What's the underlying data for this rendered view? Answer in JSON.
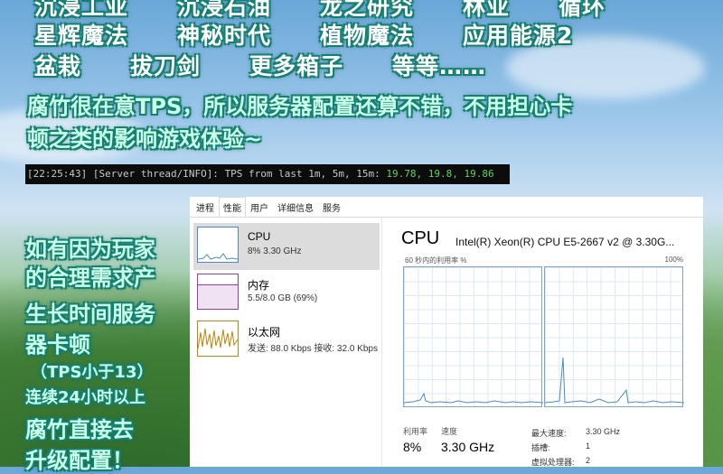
{
  "promo": {
    "row0": [
      "沉浸工业",
      "沉浸石油",
      "龙之研究",
      "林业",
      "循环"
    ],
    "row1": [
      "星辉魔法",
      "神秘时代",
      "植物魔法",
      "应用能源2"
    ],
    "row2": [
      "盆栽",
      "拔刀剑",
      "更多箱子",
      "等等……"
    ],
    "line1": "腐竹很在意TPS，所以服务器配置还算不错，不用担心卡",
    "line2": "顿之类的影响游戏体验~",
    "left": [
      "如有因为玩家",
      "的合理需求产",
      "生长时间服务",
      "器卡顿",
      "（TPS小于13）",
      "连续24小时以上",
      "腐竹直接去",
      "升级配置！"
    ]
  },
  "console": {
    "time": "[22:25:43]",
    "thread": "[Server thread/INFO]:",
    "message": "TPS from last 1m, 5m, 15m:",
    "tps": "19.78, 19.8, 19.86"
  },
  "task_manager": {
    "tabs": [
      "进程",
      "性能",
      "用户",
      "详细信息",
      "服务"
    ],
    "active_tab": "性能",
    "sidebar": [
      {
        "name": "CPU",
        "detail": "8% 3.30 GHz"
      },
      {
        "name": "内存",
        "detail": "5.5/8.0 GB (69%)"
      },
      {
        "name": "以太网",
        "detail": "发送: 88.0 Kbps  接收: 32.0 Kbps"
      }
    ],
    "cpu": {
      "title": "CPU",
      "model": "Intel(R) Xeon(R) CPU E5-2667 v2 @ 3.30G...",
      "util_label": "60 秒内的利用率 %",
      "util_max": "100%",
      "util_label_short": "利用率",
      "util_value": "8%",
      "speed_label": "速度",
      "speed_value": "3.30 GHz",
      "max_speed_label": "最大速度:",
      "max_speed_value": "3.30 GHz",
      "sockets_label": "插槽:",
      "sockets_value": "1",
      "vproc_label": "虚拟处理器:",
      "vproc_value": "2"
    }
  },
  "colors": {
    "promo_outline": "#14806f",
    "console_tps": "#5fd35f",
    "graph_line": "#7aa6d3"
  }
}
